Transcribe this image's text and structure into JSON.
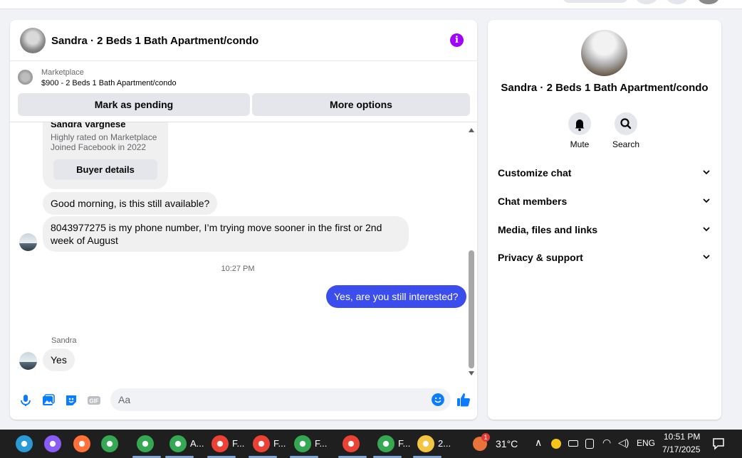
{
  "chat": {
    "title": "Sandra · 2 Beds 1 Bath Apartment/condo",
    "marketplace_label": "Marketplace",
    "listing": "$900 - 2 Beds 1 Bath Apartment/condo",
    "mark_pending_label": "Mark as pending",
    "more_options_label": "More options",
    "card": {
      "name": "Sandra Varghese",
      "line1": "Highly rated on Marketplace",
      "line2": "Joined Facebook in 2022",
      "buyer_details_label": "Buyer details"
    },
    "messages": [
      {
        "text": "Good morning, is this still available?",
        "from": "them"
      },
      {
        "text": "8043977275 is my phone number, I’m trying move sooner in the first or 2nd week of August",
        "from": "them"
      },
      {
        "text": "Yes, are you still interested?",
        "from": "me"
      },
      {
        "text": "Yes",
        "from": "them"
      }
    ],
    "timestamp": "10:27 PM",
    "sender_name": "Sandra",
    "composer_placeholder": "Aa",
    "gif_label": "GIF"
  },
  "details": {
    "title": "Sandra · 2 Beds 1 Bath Apartment/condo",
    "mute_label": "Mute",
    "search_label": "Search",
    "menu": [
      {
        "label": "Customize chat"
      },
      {
        "label": "Chat members"
      },
      {
        "label": "Media, files and links"
      },
      {
        "label": "Privacy & support"
      }
    ]
  },
  "taskbar": {
    "apps": [
      {
        "label": "",
        "icon": "edge-icon",
        "color": "#2a9ad6"
      },
      {
        "label": "",
        "icon": "copilot-icon",
        "color": "#8a5cf6"
      },
      {
        "label": "",
        "icon": "firefox-icon",
        "color": "#ff7139"
      },
      {
        "label": "",
        "icon": "chrome-icon",
        "color": "#34a853"
      },
      {
        "label": "",
        "icon": "chrome-profile-icon",
        "color": "#34a853"
      },
      {
        "label": "A...",
        "icon": "chrome-profile-icon",
        "color": "#34a853"
      },
      {
        "label": "F...",
        "icon": "chrome-profile-icon",
        "color": "#ea4335"
      },
      {
        "label": "F...",
        "icon": "chrome-profile-icon",
        "color": "#ea4335"
      },
      {
        "label": "F...",
        "icon": "chrome-profile-icon",
        "color": "#34a853"
      },
      {
        "label": "",
        "icon": "chrome-profile-icon",
        "color": "#ea4335"
      },
      {
        "label": "F...",
        "icon": "chrome-profile-icon",
        "color": "#34a853"
      },
      {
        "label": "2...",
        "icon": "file-explorer-icon",
        "color": "#f4c542"
      }
    ],
    "weather": "31°C",
    "notification_count": "1",
    "language": "ENG",
    "time": "10:51 PM",
    "date": "7/17/2025"
  },
  "colors": {
    "accent_blue": "#0a7cff",
    "outgoing_bubble": "#3b4eed",
    "info_purple": "#a100ff"
  }
}
